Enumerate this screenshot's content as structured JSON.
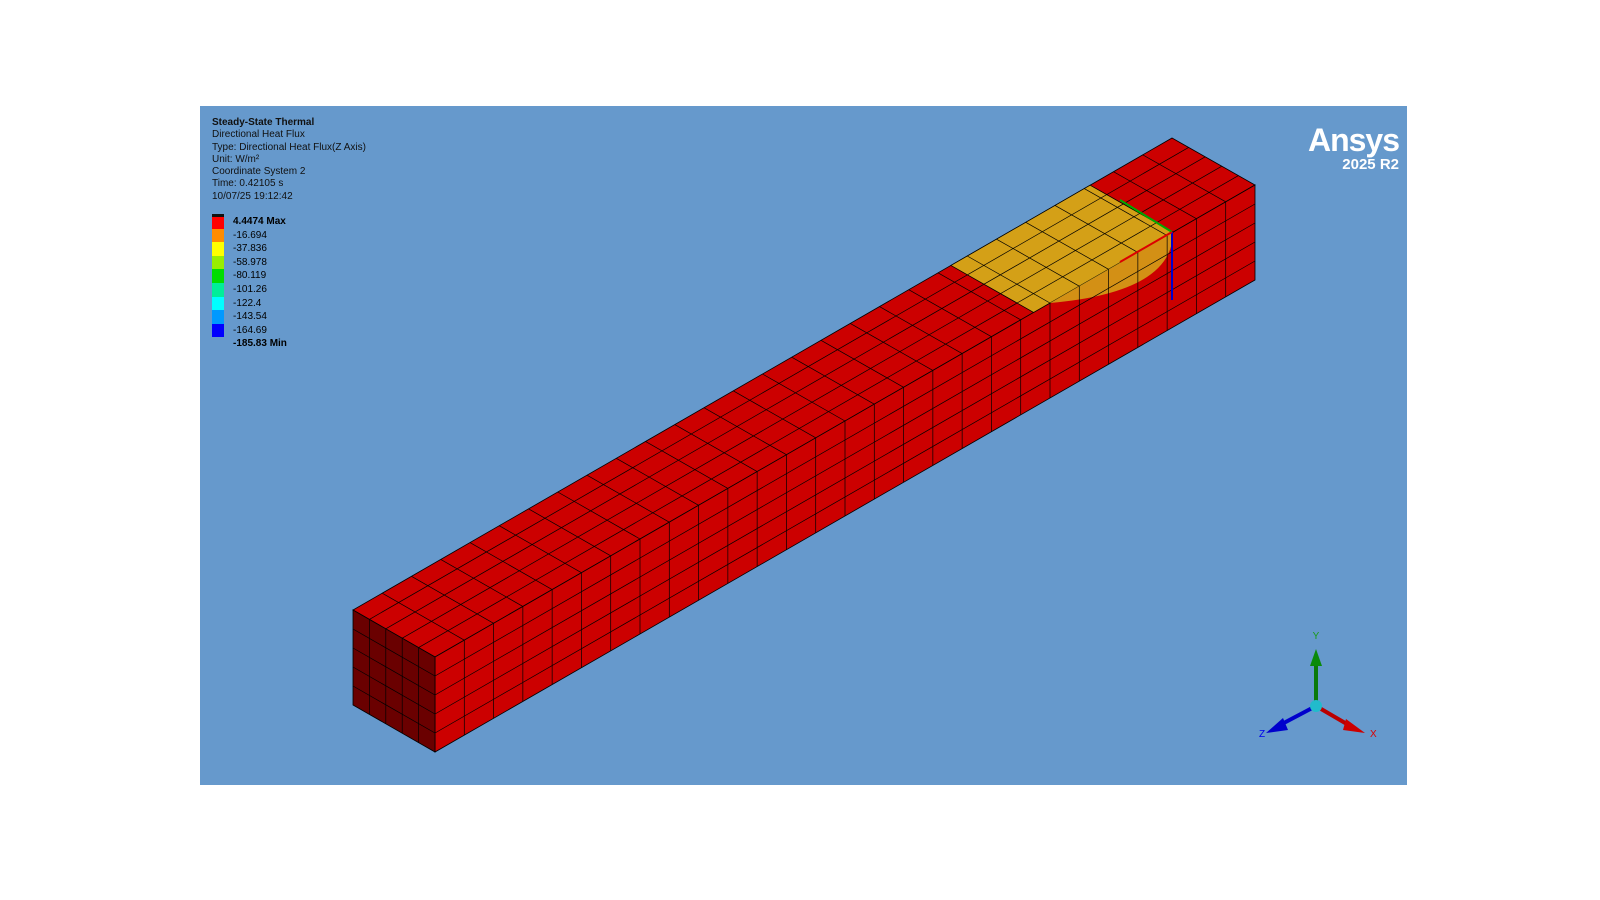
{
  "info": {
    "title": "Steady-State Thermal",
    "result": "Directional Heat Flux",
    "type": "Type: Directional Heat Flux(Z Axis)",
    "unit": "Unit: W/m²",
    "coord": "Coordinate System 2",
    "time": "Time: 0.42105 s",
    "date": "10/07/25 19:12:42"
  },
  "legend": [
    {
      "label": "4.4474 Max",
      "color": "#ff0000"
    },
    {
      "label": "-16.694",
      "color": "#ff8c00"
    },
    {
      "label": "-37.836",
      "color": "#ffff00"
    },
    {
      "label": "-58.978",
      "color": "#99ee00"
    },
    {
      "label": "-80.119",
      "color": "#00dd00"
    },
    {
      "label": "-101.26",
      "color": "#00ee99"
    },
    {
      "label": "-122.4",
      "color": "#00ffff"
    },
    {
      "label": "-143.54",
      "color": "#0099ff"
    },
    {
      "label": "-164.69",
      "color": "#0000ff"
    },
    {
      "label": "-185.83 Min",
      "color": ""
    }
  ],
  "logo": {
    "name": "Ansys",
    "version": "2025 R2"
  },
  "triad": {
    "x": "X",
    "y": "Y",
    "z": "Z"
  },
  "colors": {
    "background": "#6699cc",
    "body": "#cc0000",
    "highlight": "#d4a017"
  }
}
